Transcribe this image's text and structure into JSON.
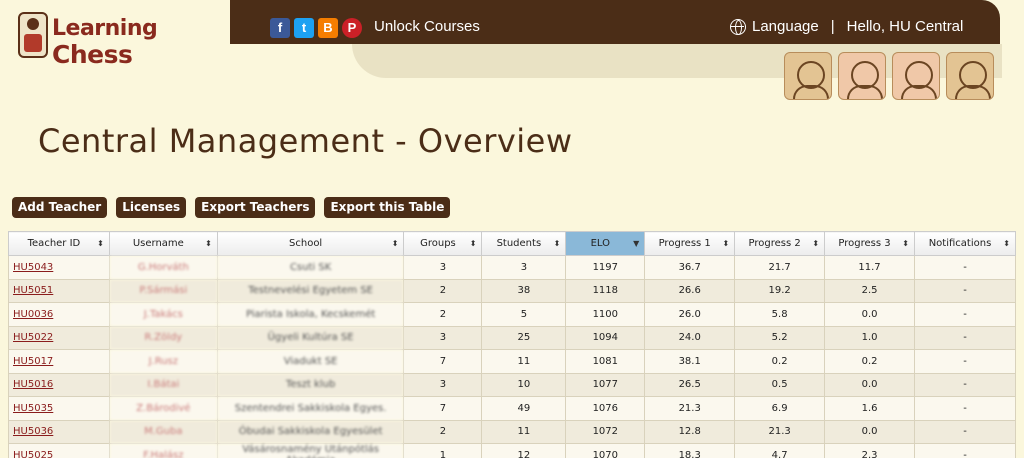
{
  "brand": {
    "line1": "Learning",
    "line2": "Chess"
  },
  "social": [
    "f",
    "t",
    "B",
    "P"
  ],
  "header": {
    "unlock": "Unlock Courses",
    "language": "Language",
    "greeting": "Hello, HU Central"
  },
  "page_title": "Central Management - Overview",
  "buttons": [
    "Add Teacher",
    "Licenses",
    "Export Teachers",
    "Export this Table"
  ],
  "table": {
    "columns": [
      "Teacher ID",
      "Username",
      "School",
      "Groups",
      "Students",
      "ELO",
      "Progress 1",
      "Progress 2",
      "Progress 3",
      "Notifications"
    ],
    "rows": [
      [
        "HU5043",
        "G.Horváth",
        "Csuti SK",
        "3",
        "3",
        "1197",
        "36.7",
        "21.7",
        "11.7",
        "-"
      ],
      [
        "HU5051",
        "P.Sármási",
        "Testnevelési Egyetem SE",
        "2",
        "38",
        "1118",
        "26.6",
        "19.2",
        "2.5",
        "-"
      ],
      [
        "HU0036",
        "J.Takács",
        "Piarista Iskola, Kecskemét",
        "2",
        "5",
        "1100",
        "26.0",
        "5.8",
        "0.0",
        "-"
      ],
      [
        "HU5022",
        "R.Zöldy",
        "Ügyeli Kultúra SE",
        "3",
        "25",
        "1094",
        "24.0",
        "5.2",
        "1.0",
        "-"
      ],
      [
        "HU5017",
        "J.Rusz",
        "Viadukt SE",
        "7",
        "11",
        "1081",
        "38.1",
        "0.2",
        "0.2",
        "-"
      ],
      [
        "HU5016",
        "I.Bátai",
        "Teszt klub",
        "3",
        "10",
        "1077",
        "26.5",
        "0.5",
        "0.0",
        "-"
      ],
      [
        "HU5035",
        "Z.Bárodivé",
        "Szentendrei Sakkiskola Egyes.",
        "7",
        "49",
        "1076",
        "21.3",
        "6.9",
        "1.6",
        "-"
      ],
      [
        "HU5036",
        "M.Guba",
        "Óbudai Sakkiskola Egyesület",
        "2",
        "11",
        "1072",
        "12.8",
        "21.3",
        "0.0",
        "-"
      ],
      [
        "HU5025",
        "F.Halász",
        "Vásárosnamény Utánpótlás Akadémia",
        "1",
        "12",
        "1070",
        "18.3",
        "4.7",
        "2.3",
        "-"
      ]
    ]
  }
}
